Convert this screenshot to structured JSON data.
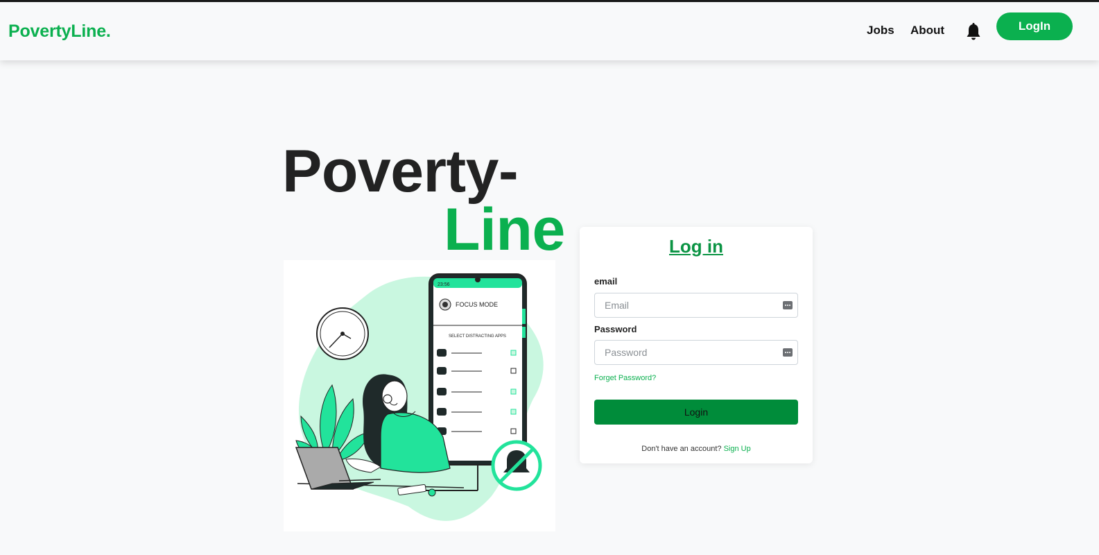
{
  "colors": {
    "brand_green": "#0bb04f",
    "button_green": "#008c3a",
    "mint": "#c9f7e0",
    "accent_mint": "#22e39b",
    "dark": "#222222"
  },
  "navbar": {
    "brand": "PovertyLine.",
    "links": [
      "Jobs",
      "About"
    ],
    "bell_icon": "bell-icon",
    "login_button": "LogIn"
  },
  "hero": {
    "title_line1": "Poverty-",
    "title_line2": "Line"
  },
  "illustration": {
    "phone_time": "23:56",
    "focus_mode": "FOCUS MODE",
    "select_label": "SELECT DISTRACTING APPS",
    "apps": [
      {
        "icon": "play-icon",
        "checked": true
      },
      {
        "icon": "chat-icon",
        "checked": false
      },
      {
        "icon": "music-icon",
        "checked": true
      },
      {
        "icon": "mail-icon",
        "checked": true
      },
      {
        "icon": "location-icon",
        "checked": false
      }
    ]
  },
  "login_card": {
    "title": "Log in",
    "email_label": "email",
    "email_placeholder": "Email",
    "email_value": "",
    "password_label": "Password",
    "password_placeholder": "Password",
    "password_value": "",
    "forgot": "Forget Password?",
    "submit": "Login",
    "no_account": "Don't have an account?",
    "signup": "Sign Up"
  }
}
